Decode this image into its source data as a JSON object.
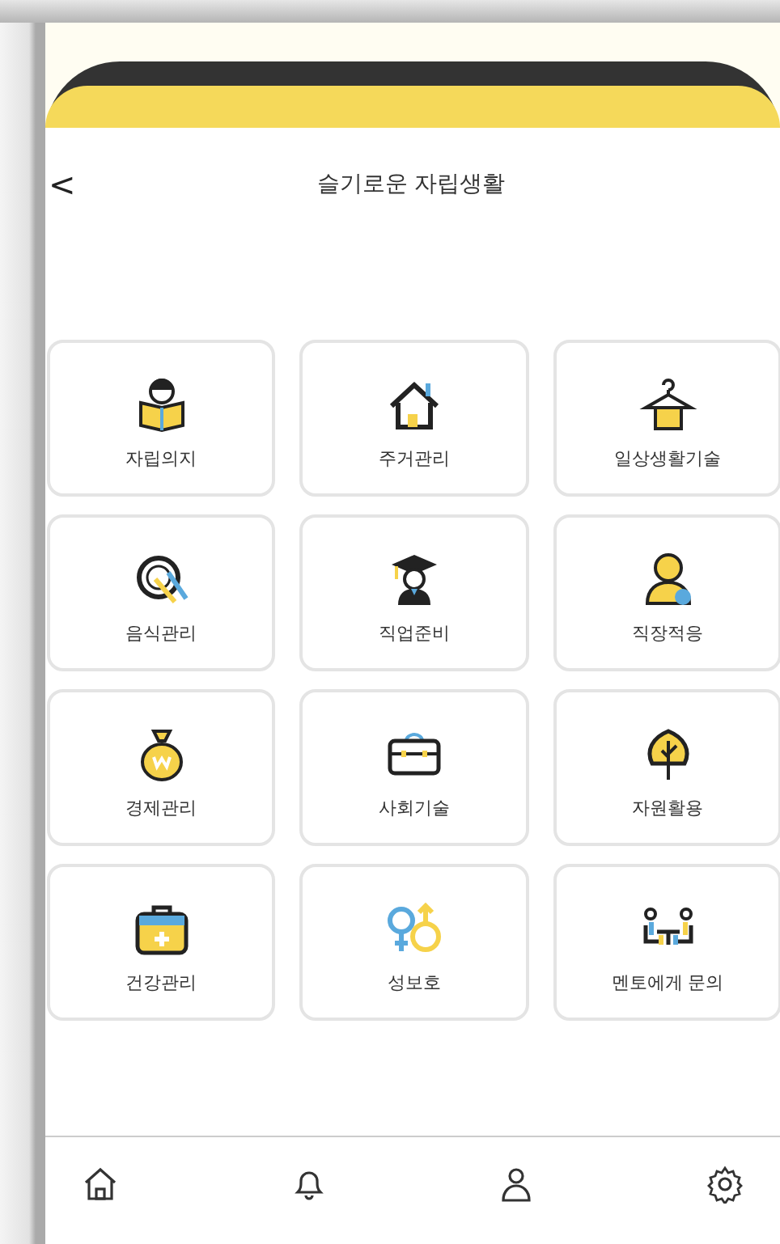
{
  "header": {
    "back": "<",
    "title": "슬기로운 자립생활"
  },
  "tiles": [
    {
      "kind": "reader",
      "label": "자립의지"
    },
    {
      "kind": "house",
      "label": "주거관리"
    },
    {
      "kind": "hanger",
      "label": "일상생활기술"
    },
    {
      "kind": "plate",
      "label": "음식관리"
    },
    {
      "kind": "graduate",
      "label": "직업준비"
    },
    {
      "kind": "person",
      "label": "직장적응"
    },
    {
      "kind": "moneybag",
      "label": "경제관리"
    },
    {
      "kind": "briefcase",
      "label": "사회기술"
    },
    {
      "kind": "leaf",
      "label": "자원활용"
    },
    {
      "kind": "firstaid",
      "label": "건강관리"
    },
    {
      "kind": "gender",
      "label": "성보호"
    },
    {
      "kind": "meeting",
      "label": "멘토에게 문의"
    }
  ],
  "nav": [
    {
      "kind": "home"
    },
    {
      "kind": "bell"
    },
    {
      "kind": "user"
    },
    {
      "kind": "settings"
    }
  ]
}
